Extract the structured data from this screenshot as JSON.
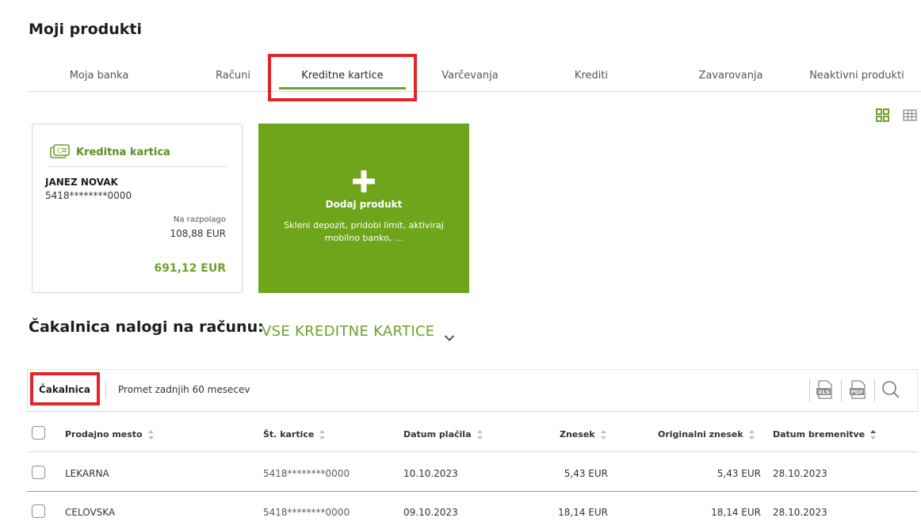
{
  "page_title": "Moji produkti",
  "tabs": [
    "Moja banka",
    "Računi",
    "Kreditne kartice",
    "Varčevanja",
    "Krediti",
    "Zavarovanja",
    "Neaktivni produkti"
  ],
  "active_tab": "Kreditne kartice",
  "view_icons": [
    "grid-view-icon",
    "table-view-icon"
  ],
  "card": {
    "type_label": "Kreditna kartica",
    "holder": "JANEZ NOVAK",
    "number": "5418********0000",
    "available_label": "Na razpolago",
    "available_value": "108,88 EUR",
    "balance": "691,12 EUR"
  },
  "add_product": {
    "title": "Dodaj produkt",
    "description": "Skleni depozit, pridobi limit, aktiviraj mobilno banko, ..."
  },
  "queue": {
    "title": "Čakalnica nalogi na računu:",
    "selected": "VSE KREDITNE KARTICE"
  },
  "subtabs": [
    "Čakalnica",
    "Promet zadnjih 60 mesecev"
  ],
  "tools": [
    "xls-export-icon",
    "pdf-export-icon",
    "search-icon"
  ],
  "table": {
    "headers": [
      "Prodajno mesto",
      "Št. kartice",
      "Datum plačila",
      "Znesek",
      "Originalni znesek",
      "Datum bremenitve"
    ],
    "rows": [
      [
        "LEKARNA",
        "5418********0000",
        "10.10.2023",
        "5,43 EUR",
        "5,43 EUR",
        "28.10.2023"
      ],
      [
        "CELOVSKA",
        "5418********0000",
        "09.10.2023",
        "18,14 EUR",
        "18,14 EUR",
        "28.10.2023"
      ]
    ]
  },
  "colors": {
    "accent": "#6ca12a",
    "tile": "#6fa51a",
    "highlight": "#e3242b"
  }
}
